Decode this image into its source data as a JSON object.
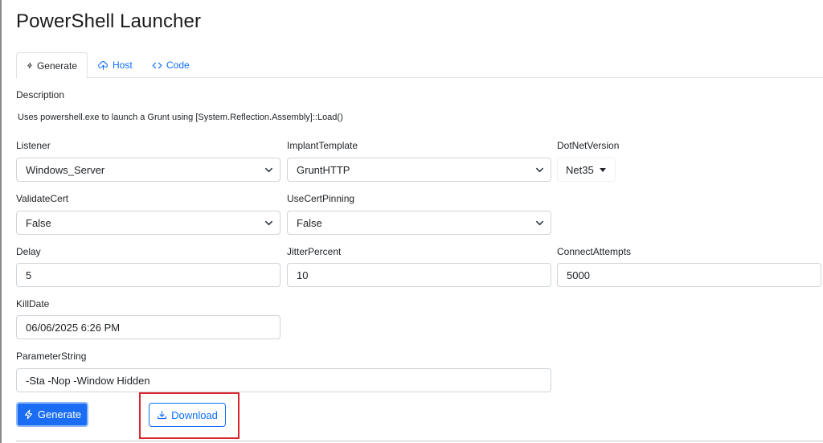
{
  "page": {
    "title": "PowerShell Launcher"
  },
  "tabs": [
    {
      "label": "Generate",
      "icon": "lightning-icon",
      "active": true
    },
    {
      "label": "Host",
      "icon": "cloud-upload-icon",
      "active": false
    },
    {
      "label": "Code",
      "icon": "code-icon",
      "active": false
    }
  ],
  "description": {
    "label": "Description",
    "text": "Uses powershell.exe to launch a Grunt using [System.Reflection.Assembly]::Load()"
  },
  "form": {
    "listener": {
      "label": "Listener",
      "value": "Windows_Server"
    },
    "implant_template": {
      "label": "ImplantTemplate",
      "value": "GruntHTTP"
    },
    "dotnet_version": {
      "label": "DotNetVersion",
      "value": "Net35"
    },
    "validate_cert": {
      "label": "ValidateCert",
      "value": "False"
    },
    "use_cert_pinning": {
      "label": "UseCertPinning",
      "value": "False"
    },
    "delay": {
      "label": "Delay",
      "value": "5"
    },
    "jitter_percent": {
      "label": "JitterPercent",
      "value": "10"
    },
    "connect_attempts": {
      "label": "ConnectAttempts",
      "value": "5000"
    },
    "kill_date": {
      "label": "KillDate",
      "value": "06/06/2025 6:26 PM"
    },
    "parameter_string": {
      "label": "ParameterString",
      "value": "-Sta -Nop -Window Hidden"
    }
  },
  "actions": {
    "generate_label": "Generate",
    "download_label": "Download"
  },
  "colors": {
    "primary": "#1b6ef3",
    "link": "#0d6efd",
    "highlight": "#d9262b"
  }
}
